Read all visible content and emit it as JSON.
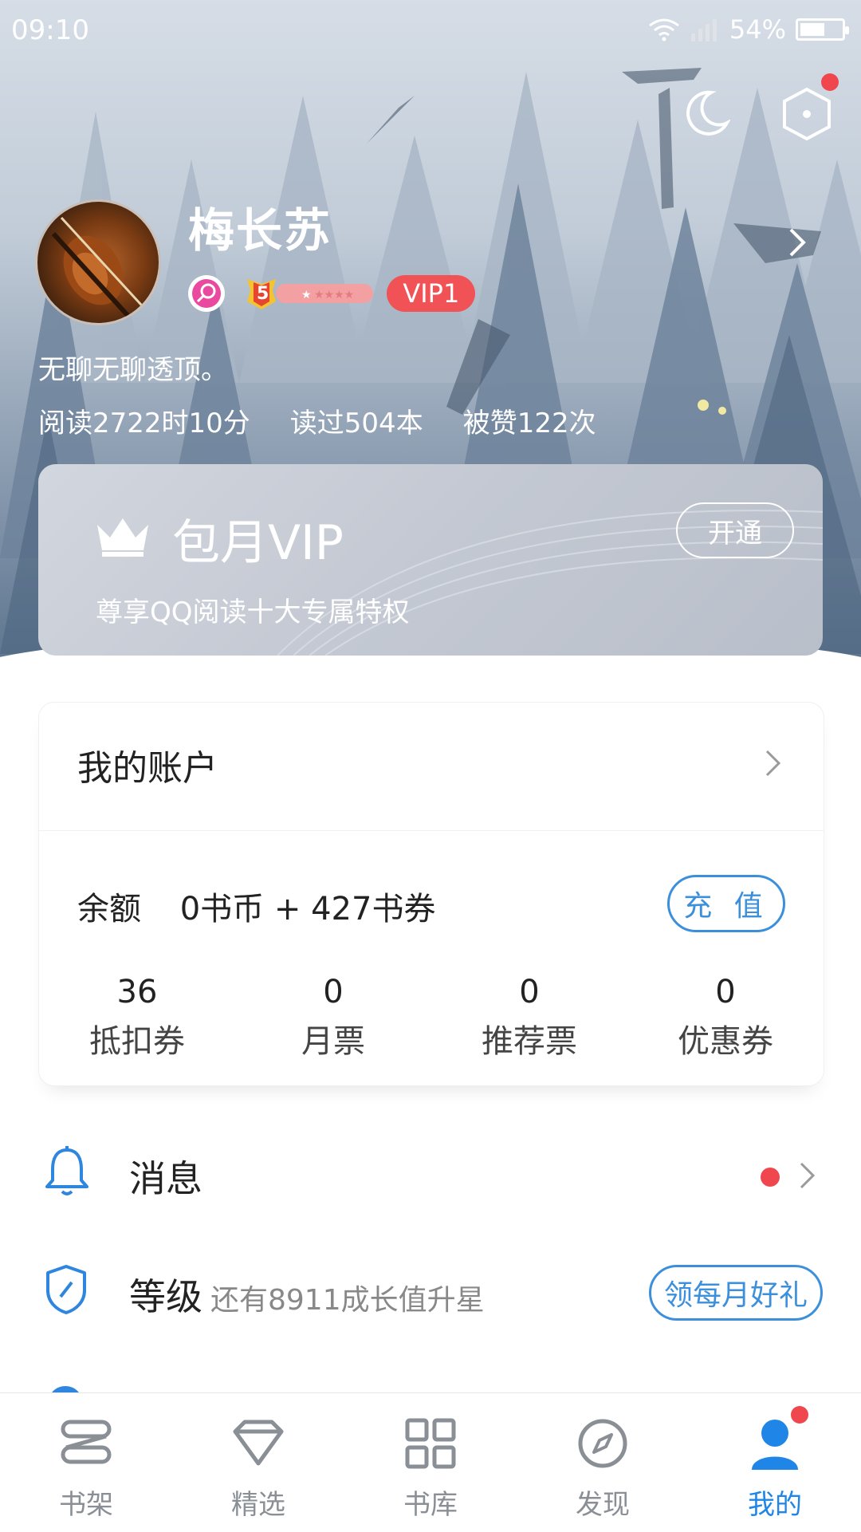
{
  "status_bar": {
    "time": "09:10",
    "battery": "54%",
    "battery_level": 0.54
  },
  "profile": {
    "name": "梅长苏",
    "level_num": "5",
    "vip_badge": "VIP1",
    "bio": "无聊无聊透顶。",
    "stats": [
      "阅读2722时10分",
      "读过504本",
      "被赞122次"
    ]
  },
  "vip_card": {
    "title": "包月VIP",
    "subtitle": "尊享QQ阅读十大专属特权",
    "button": "开通"
  },
  "account": {
    "title": "我的账户",
    "balance_label": "余额",
    "balance_value": "0书币 + 427书券",
    "recharge": "充 值",
    "counters": [
      {
        "value": "36",
        "label": "抵扣券"
      },
      {
        "value": "0",
        "label": "月票"
      },
      {
        "value": "0",
        "label": "推荐票"
      },
      {
        "value": "0",
        "label": "优惠券"
      }
    ]
  },
  "rows": {
    "messages": {
      "label": "消息"
    },
    "level": {
      "label": "等级",
      "hint": "还有8911成长值升星",
      "button": "领每月好礼"
    }
  },
  "nav": [
    {
      "label": "书架",
      "icon": "bookshelf-icon"
    },
    {
      "label": "精选",
      "icon": "diamond-icon"
    },
    {
      "label": "书库",
      "icon": "grid-icon"
    },
    {
      "label": "发现",
      "icon": "compass-icon"
    },
    {
      "label": "我的",
      "icon": "profile-icon",
      "active": true
    }
  ],
  "colors": {
    "accent": "#1f86e8",
    "badge_red": "#f0474e",
    "vip_red": "#f05256",
    "outline_blue": "#3b8fdb"
  }
}
